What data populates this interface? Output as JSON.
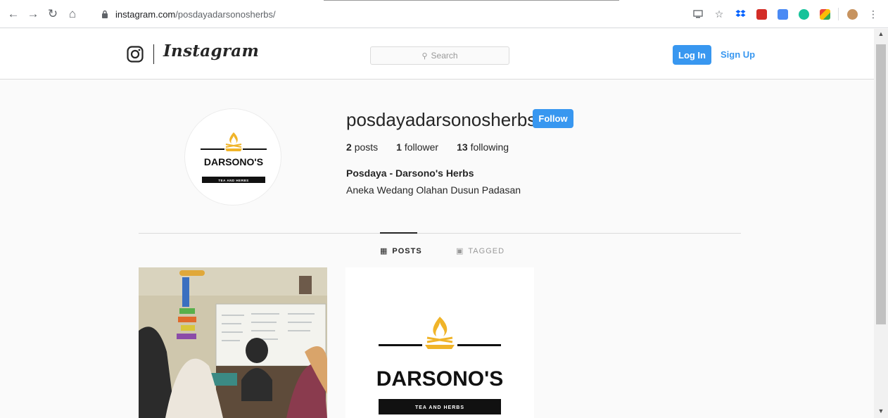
{
  "browser": {
    "url_host": "instagram.com",
    "url_path": "/posdayadarsonosherbs/",
    "extensions": [
      "cast-icon",
      "star-icon",
      "dropbox-icon",
      "lastpass-icon",
      "translate-icon",
      "grammarly-icon",
      "colorful-icon",
      "avatar-icon",
      "menu-icon"
    ]
  },
  "header": {
    "wordmark": "Instagram",
    "search_placeholder": "Search",
    "login_label": "Log In",
    "signup_label": "Sign Up"
  },
  "profile": {
    "username": "posdayadarsonosherbs",
    "follow_label": "Follow",
    "posts_count": "2",
    "posts_label": "posts",
    "followers_count": "1",
    "followers_label": "follower",
    "following_count": "13",
    "following_label": "following",
    "full_name": "Posdaya - Darsono's Herbs",
    "bio": "Aneka Wedang Olahan Dusun Padasan",
    "logo_title": "DARSONO'S",
    "logo_subtitle": "TEA AND HERBS"
  },
  "tabs": [
    {
      "label": "POSTS",
      "icon": "grid-icon",
      "active": true
    },
    {
      "label": "TAGGED",
      "icon": "tag-icon",
      "active": false
    }
  ],
  "colors": {
    "accent": "#3897f0",
    "text": "#262626",
    "muted": "#999999",
    "logo_flame": "#f0b429"
  }
}
